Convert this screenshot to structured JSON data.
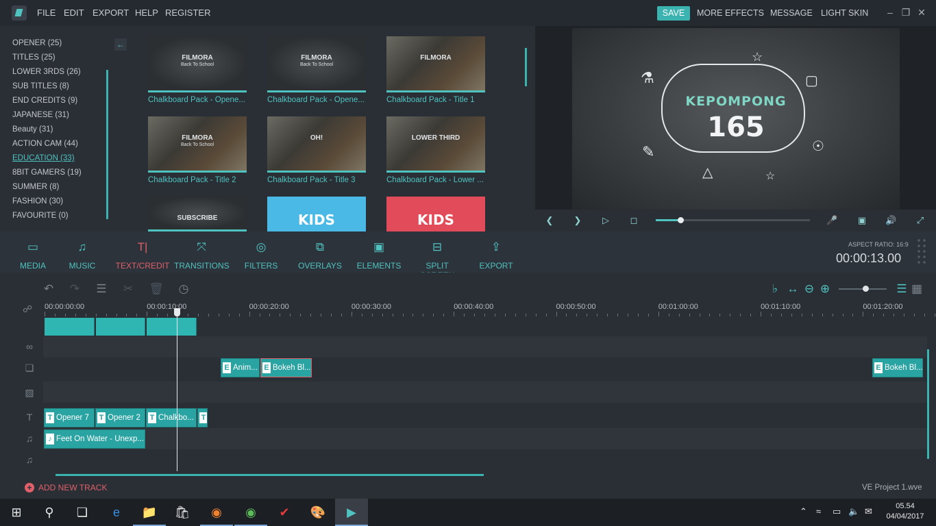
{
  "menubar": {
    "menus": [
      "FILE",
      "EDIT",
      "EXPORT",
      "HELP",
      "REGISTER"
    ],
    "save": "SAVE",
    "right_menus": [
      "MORE EFFECTS",
      "MESSAGE",
      "LIGHT SKIN"
    ]
  },
  "categories": [
    {
      "label": "OPENER (25)"
    },
    {
      "label": "TITLES (25)"
    },
    {
      "label": "LOWER 3RDS (26)"
    },
    {
      "label": "SUB TITLES (8)"
    },
    {
      "label": "END CREDITS (9)"
    },
    {
      "label": "JAPANESE (31)"
    },
    {
      "label": "Beauty (31)"
    },
    {
      "label": "ACTION CAM (44)"
    },
    {
      "label": "EDUCATION (33)",
      "active": true
    },
    {
      "label": "8BIT GAMERS (19)"
    },
    {
      "label": "SUMMER (8)"
    },
    {
      "label": "FASHION (30)"
    },
    {
      "label": "FAVOURITE (0)"
    }
  ],
  "thumbnails": [
    {
      "title": "Chalkboard Pack - Opene...",
      "art": "FILMORA",
      "art2": "Back To School"
    },
    {
      "title": "Chalkboard Pack - Opene...",
      "art": "FILMORA",
      "art2": "Back To School"
    },
    {
      "title": "Chalkboard Pack - Title 1",
      "art": "FILMORA",
      "art2": ""
    },
    {
      "title": "Chalkboard Pack - Title 2",
      "art": "FILMORA",
      "art2": "Back To School"
    },
    {
      "title": "Chalkboard Pack - Title 3",
      "art": "OH!",
      "art2": ""
    },
    {
      "title": "Chalkboard Pack - Lower ...",
      "art": "LOWER THIRD",
      "art2": ""
    },
    {
      "title": "",
      "art": "SUBSCRIBE",
      "art2": ""
    },
    {
      "title": "",
      "art": "KIDS",
      "art2": ""
    },
    {
      "title": "",
      "art": "KIDS",
      "art2": ""
    }
  ],
  "preview": {
    "title": "KEPOMPONG",
    "number": "165",
    "progress": 0.16
  },
  "toolbar": [
    {
      "label": "MEDIA",
      "icon": "folder-icon"
    },
    {
      "label": "MUSIC",
      "icon": "music-icon"
    },
    {
      "label": "TEXT/CREDIT",
      "icon": "text-icon",
      "active": true
    },
    {
      "label": "TRANSITIONS",
      "icon": "transitions-icon"
    },
    {
      "label": "FILTERS",
      "icon": "filters-icon"
    },
    {
      "label": "OVERLAYS",
      "icon": "overlays-icon"
    },
    {
      "label": "ELEMENTS",
      "icon": "image-icon"
    },
    {
      "label": "SPLIT SCREEN",
      "icon": "split-screen-icon"
    },
    {
      "label": "EXPORT",
      "icon": "export-icon"
    }
  ],
  "aspect_ratio": "ASPECT RATIO: 16:9",
  "timecode": "00:00:13.00",
  "ruler": [
    "00:00:00:00",
    "00:00:10:00",
    "00:00:20:00",
    "00:00:30:00",
    "00:00:40:00",
    "00:00:50:00",
    "00:01:00:00",
    "00:01:10:00",
    "00:01:20:00"
  ],
  "element_clips": [
    {
      "label": "Anim..."
    },
    {
      "label": "Bokeh Bl..."
    },
    {
      "label": "Bokeh Bl..."
    }
  ],
  "text_clips": [
    {
      "label": "Opener 7"
    },
    {
      "label": "Opener 2"
    },
    {
      "label": "Chalkbo..."
    },
    {
      "label": ""
    }
  ],
  "audio_clip": "Feet On Water - Unexp...",
  "zoom_level": 0.55,
  "add_track": "ADD NEW TRACK",
  "project_name": "VE Project 1.wve",
  "taskbar": {
    "time": "05.54",
    "date": "04/04/2017"
  },
  "colors": {
    "accent": "#3bb3b1",
    "active": "#e0606a",
    "background": "#2a2f36"
  }
}
